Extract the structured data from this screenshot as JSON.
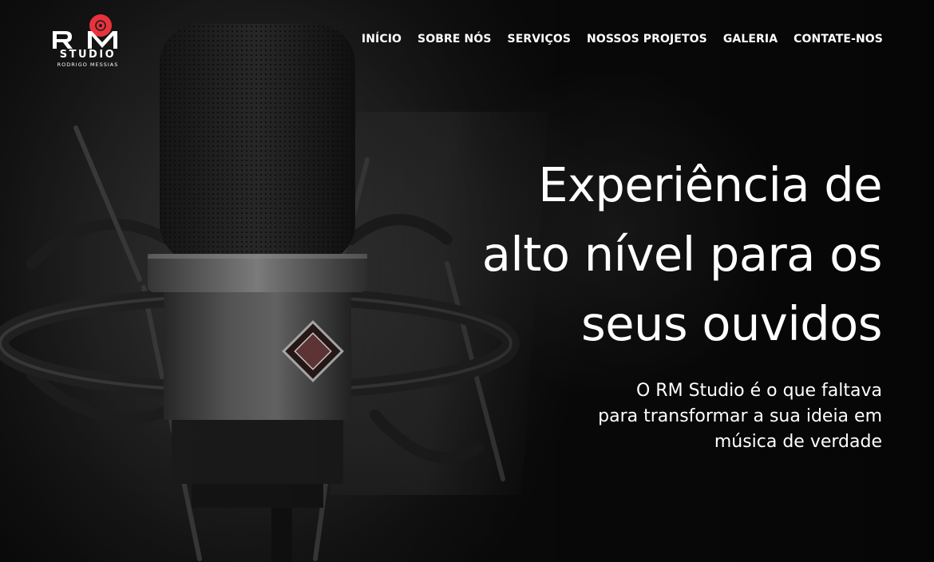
{
  "brand": {
    "logo_main": "RM",
    "logo_word": "STUDIO",
    "logo_tagline": "RODRIGO MESSIAS",
    "accent_color": "#e8323c"
  },
  "nav": {
    "items": [
      {
        "label": "INÍCIO"
      },
      {
        "label": "SOBRE NÓS"
      },
      {
        "label": "SERVIÇOS"
      },
      {
        "label": "NOSSOS PROJETOS"
      },
      {
        "label": "GALERIA"
      },
      {
        "label": "CONTATE-NOS"
      }
    ]
  },
  "hero": {
    "title_lines": [
      "Experiência de",
      "alto nível para os",
      "seus ouvidos"
    ],
    "subtitle_lines": [
      "O RM Studio é o que faltava",
      "para transformar a sua ideia em",
      "música de verdade"
    ],
    "background_icon": "studio-microphone"
  }
}
